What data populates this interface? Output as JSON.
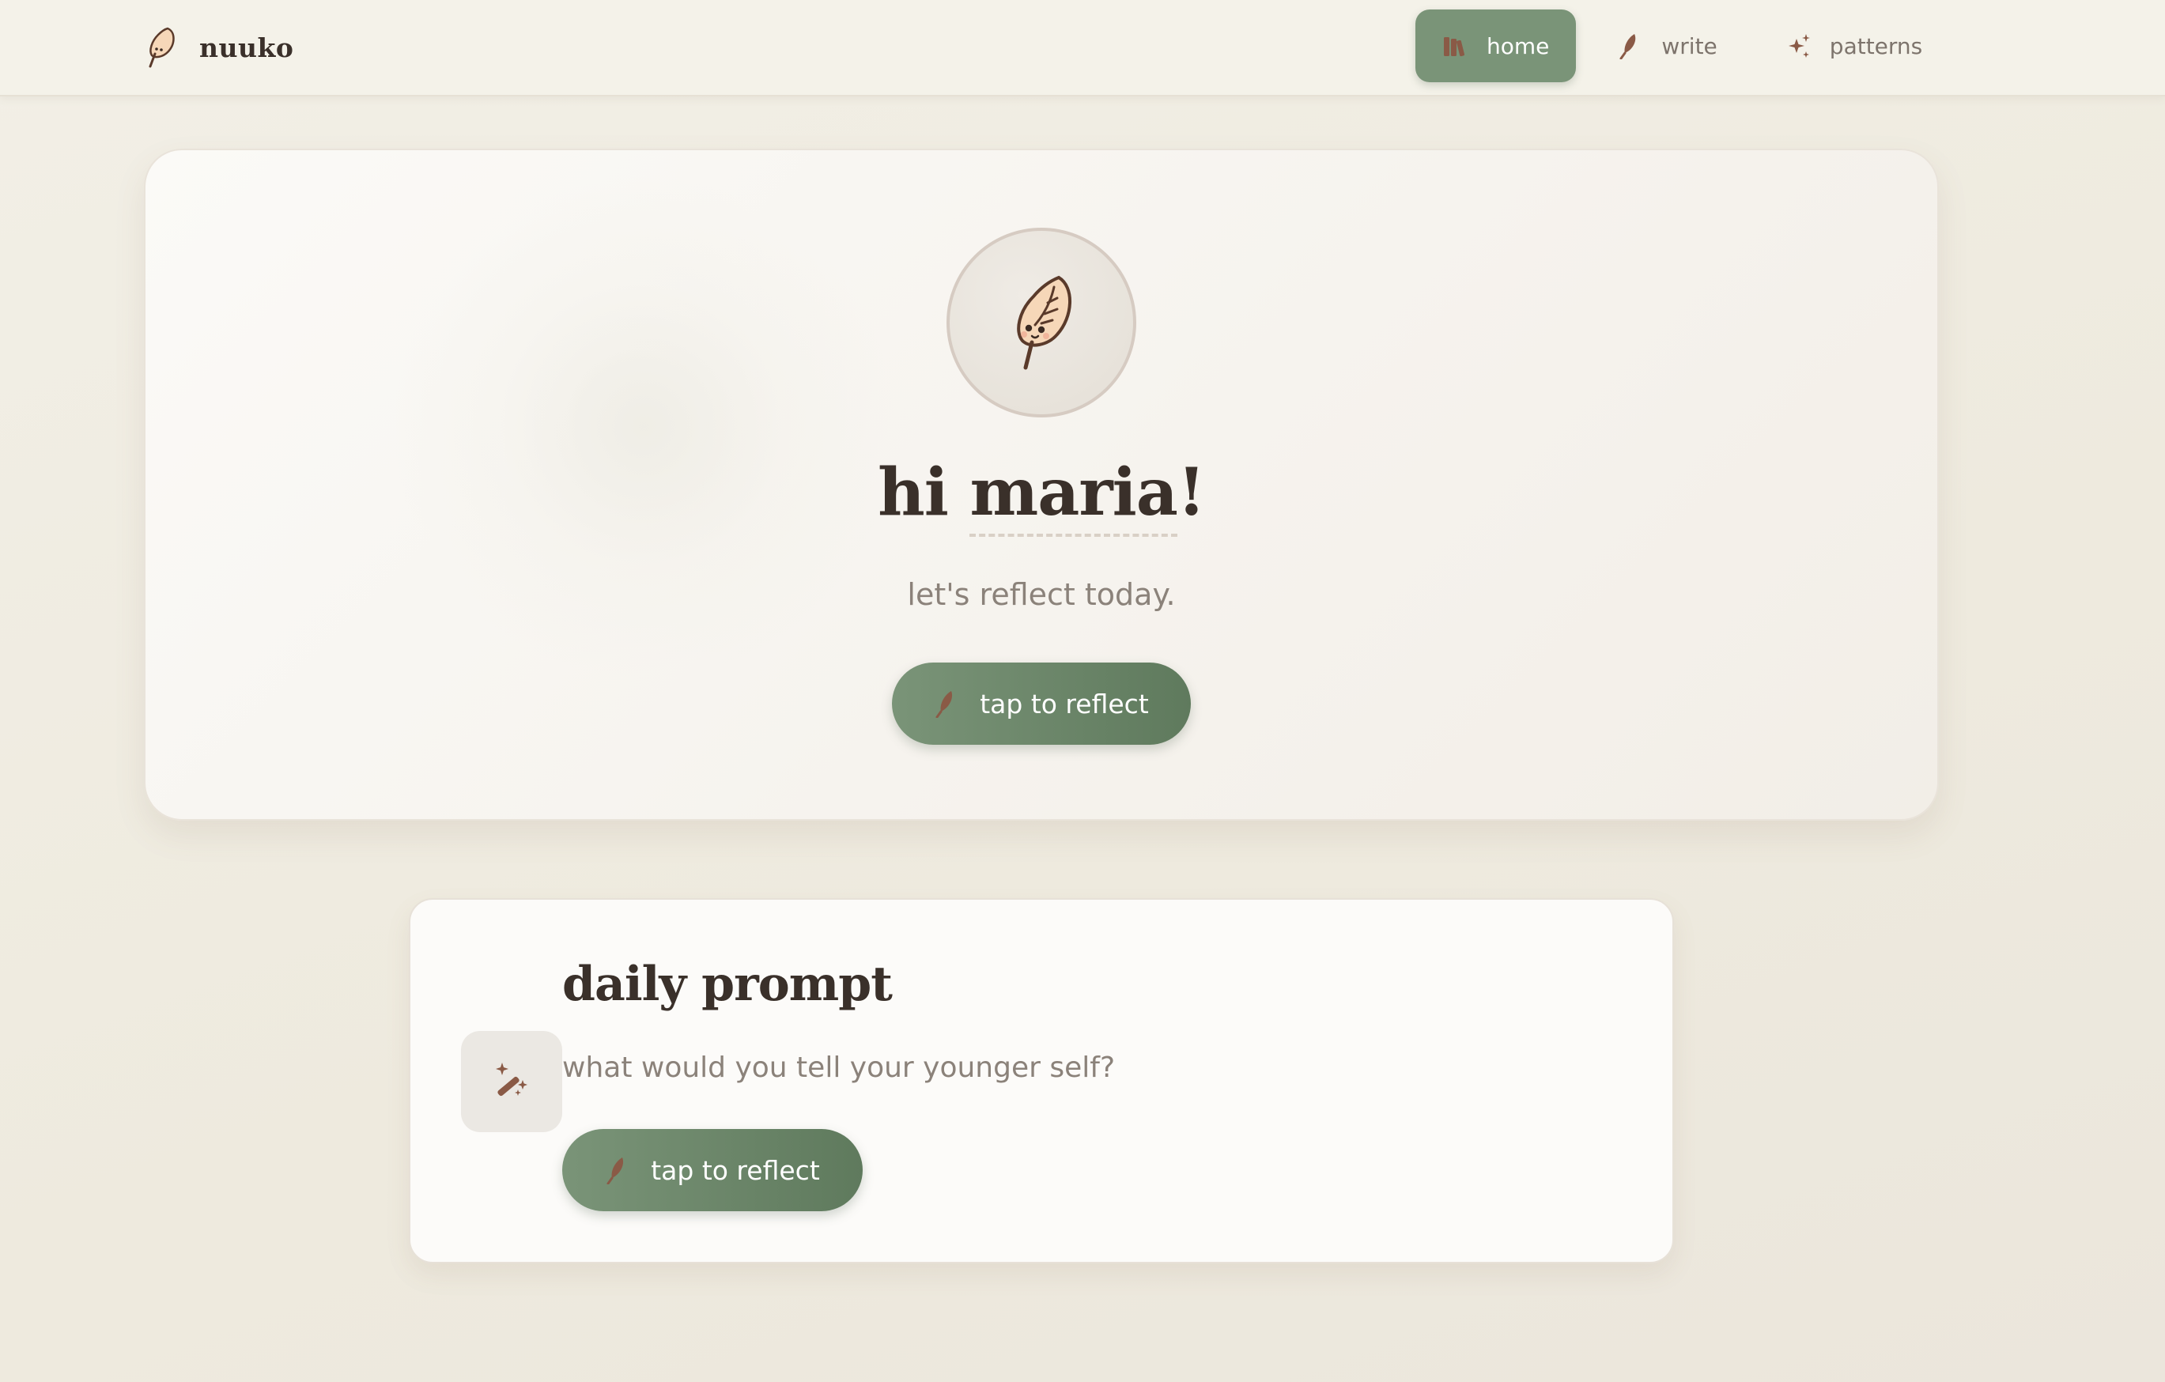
{
  "brand": {
    "name": "nuuko",
    "logo_icon": "feather-mascot-icon"
  },
  "nav": {
    "items": [
      {
        "label": "home",
        "icon": "books-icon",
        "active": true
      },
      {
        "label": "write",
        "icon": "feather-icon",
        "active": false
      },
      {
        "label": "patterns",
        "icon": "sparkles-icon",
        "active": false
      }
    ]
  },
  "hero": {
    "avatar_icon": "feather-mascot-icon",
    "greeting_prefix": "hi ",
    "user_name": "maria",
    "greeting_suffix": "!",
    "subtitle": "let's reflect today.",
    "cta_label": "tap to reflect"
  },
  "daily_prompt": {
    "title": "daily prompt",
    "icon": "magic-wand-icon",
    "question": "what would you tell your younger self?",
    "cta_label": "tap to reflect"
  },
  "colors": {
    "accent": "#7a9478",
    "accent_dark": "#5f7a5d",
    "icon_brown": "#8a5a46",
    "background": "#f1eee6",
    "text_primary": "#3a302a",
    "text_muted": "#8b827a"
  }
}
